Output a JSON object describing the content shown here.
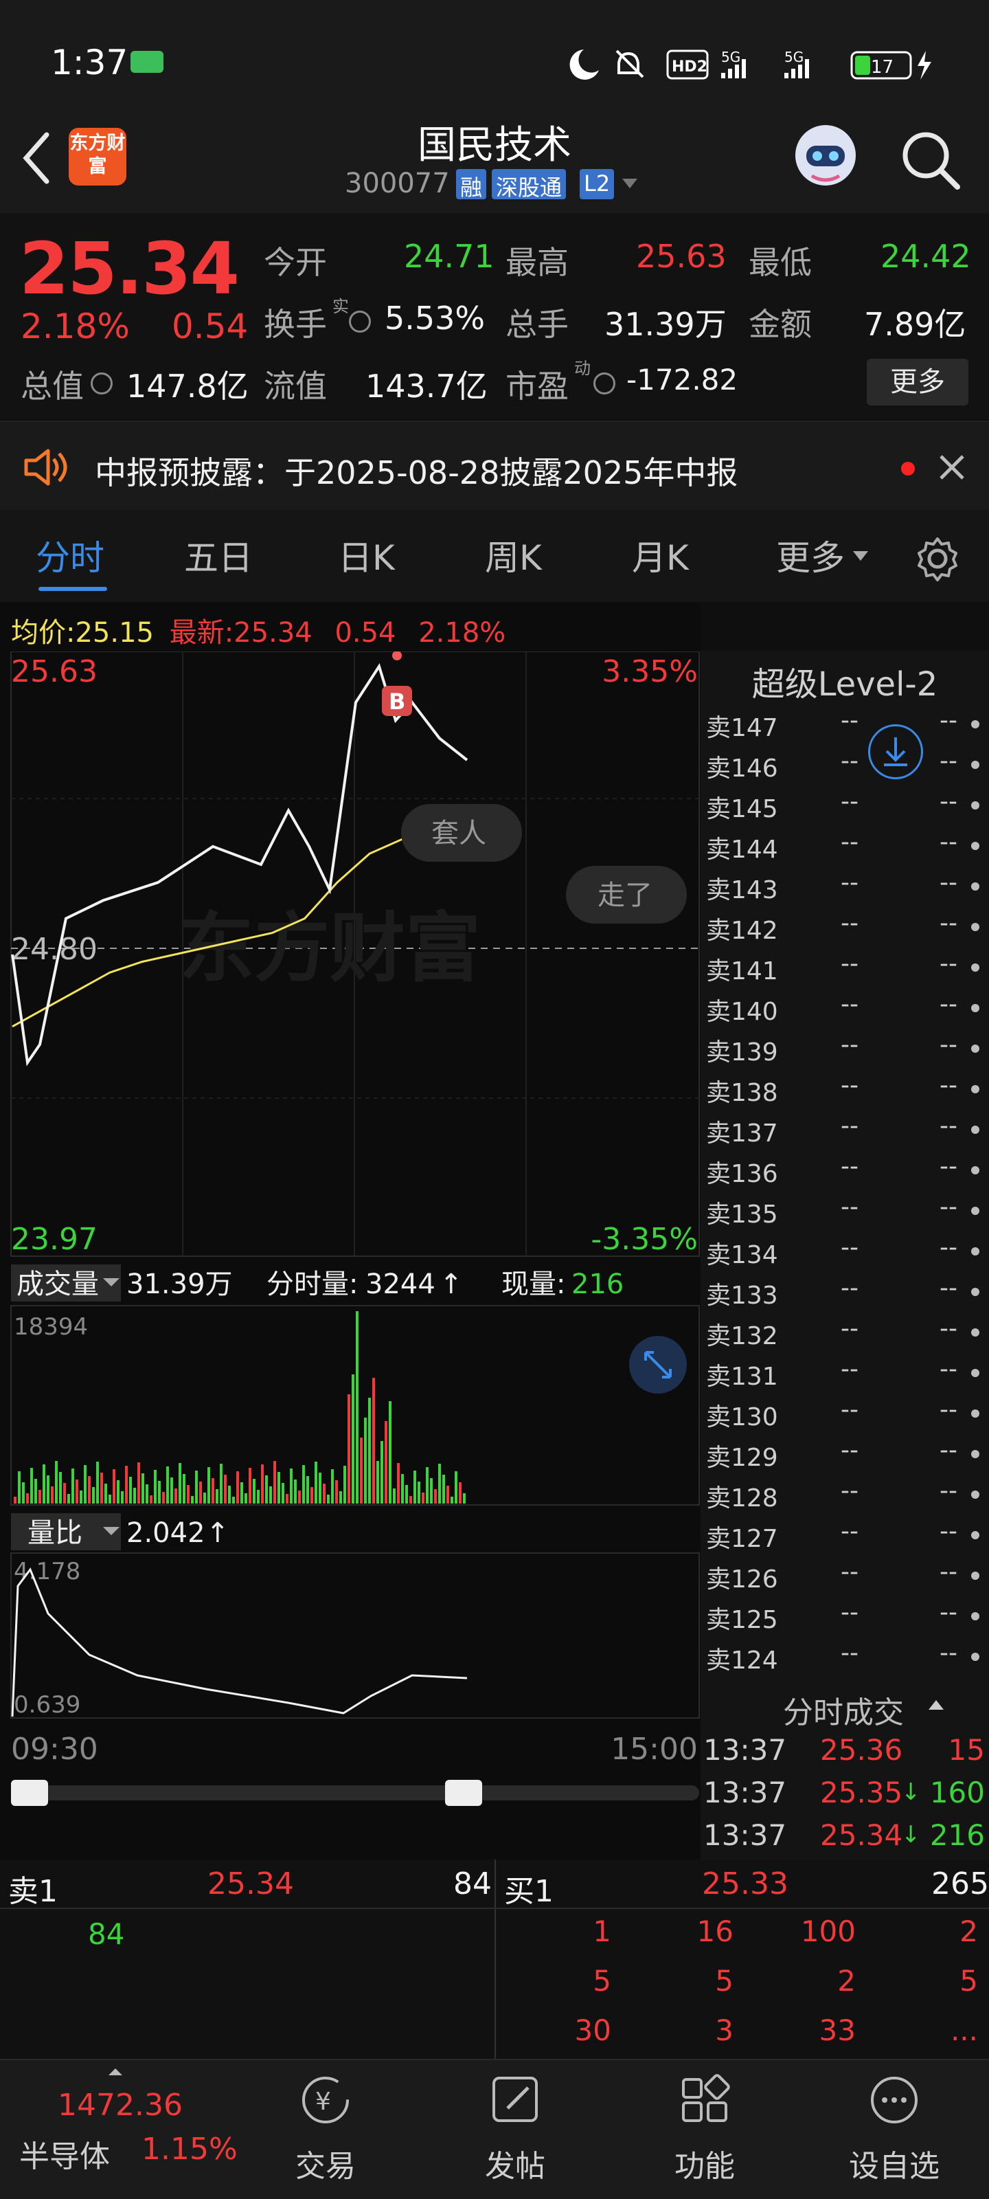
{
  "status_bar": {
    "time": "1:37",
    "battery": "17",
    "net1": "5G",
    "net2": "5G",
    "hd": "HD2"
  },
  "header": {
    "title": "国民技术",
    "code": "300077",
    "tags": [
      "融",
      "深股通",
      "L2"
    ],
    "logo": "东方财富"
  },
  "quote": {
    "price": "25.34",
    "pct": "2.18%",
    "chg": "0.54",
    "open_label": "今开",
    "open": "24.71",
    "high_label": "最高",
    "high": "25.63",
    "low_label": "最低",
    "low": "24.42",
    "turnover_label": "换手",
    "turnover_sup": "实",
    "turnover": "5.53%",
    "volume_label": "总手",
    "volume": "31.39万",
    "amount_label": "金额",
    "amount": "7.89亿",
    "mktcap_label": "总值",
    "mktcap": "147.8亿",
    "float_label": "流值",
    "float": "143.7亿",
    "pe_label": "市盈",
    "pe_sup": "动",
    "pe": "-172.82",
    "more": "更多"
  },
  "notice": {
    "text": "中报预披露：于2025-08-28披露2025年中报"
  },
  "tabs": [
    "分时",
    "五日",
    "日K",
    "周K",
    "月K",
    "更多"
  ],
  "chart": {
    "avg_label": "均价:",
    "avg": "25.15",
    "latest_label": "最新:",
    "latest": "25.34",
    "latest_chg": "0.54",
    "latest_pct": "2.18%",
    "top_price": "25.63",
    "top_pct": "3.35%",
    "mid_price": "24.80",
    "bottom_price": "23.97",
    "bottom_pct": "-3.35%",
    "watermark": "东方财富",
    "marker": "B",
    "bubble1": "套人",
    "bubble2": "走了",
    "vol_selector": "成交量",
    "vol_total": "31.39万",
    "vol_tick_label": "分时量:",
    "vol_tick": "3244",
    "vol_now_label": "现量:",
    "vol_now": "216",
    "vol_max": "18394",
    "ratio_selector": "量比",
    "ratio_val": "2.042",
    "ratio_max": "4.178",
    "ratio_min": "0.639",
    "time_start": "09:30",
    "time_end": "15:00"
  },
  "level2": {
    "title": "超级Level-2",
    "rows": [
      "卖147",
      "卖146",
      "卖145",
      "卖144",
      "卖143",
      "卖142",
      "卖141",
      "卖140",
      "卖139",
      "卖138",
      "卖137",
      "卖136",
      "卖135",
      "卖134",
      "卖133",
      "卖132",
      "卖131",
      "卖130",
      "卖129",
      "卖128",
      "卖127",
      "卖126",
      "卖125",
      "卖124"
    ],
    "dash": "--",
    "trades_title": "分时成交",
    "trades": [
      {
        "time": "13:37",
        "price": "25.36",
        "vol": "15",
        "arrow": ""
      },
      {
        "time": "13:37",
        "price": "25.35",
        "vol": "160",
        "arrow": "↓"
      },
      {
        "time": "13:37",
        "price": "25.34",
        "vol": "216",
        "arrow": "↓"
      }
    ]
  },
  "orderbook": {
    "sell_label": "卖1",
    "sell_price": "25.34",
    "sell_qty": "84",
    "sell_orders": [
      "84"
    ],
    "buy_label": "买1",
    "buy_price": "25.33",
    "buy_qty": "265",
    "buy_orders": [
      "1",
      "16",
      "100",
      "2",
      "5",
      "5",
      "2",
      "5",
      "30",
      "3",
      "33",
      "..."
    ]
  },
  "bottom_nav": {
    "index_value": "1472.36",
    "index_name": "半导体",
    "index_pct": "1.15%",
    "items": [
      "交易",
      "发帖",
      "功能",
      "设自选"
    ]
  },
  "chart_data": {
    "type": "line",
    "title": "",
    "xlabel": "",
    "ylabel": "",
    "ylim": [
      23.97,
      25.63
    ],
    "x": [
      "09:30",
      "15:00"
    ],
    "series": [
      {
        "name": "",
        "values": [
          24.8,
          24.5,
          24.55,
          24.9,
          24.95,
          25.0,
          25.1,
          25.05,
          25.2,
          25.1,
          24.98,
          25.5,
          25.6,
          25.45,
          25.5,
          25.4,
          25.34
        ]
      },
      {
        "name": "",
        "values": [
          24.6,
          24.65,
          24.7,
          24.75,
          24.78,
          24.8,
          24.82,
          24.84,
          24.86,
          24.9,
          25.0,
          25.08,
          25.12,
          25.14,
          25.15
        ]
      }
    ],
    "grid": true
  }
}
